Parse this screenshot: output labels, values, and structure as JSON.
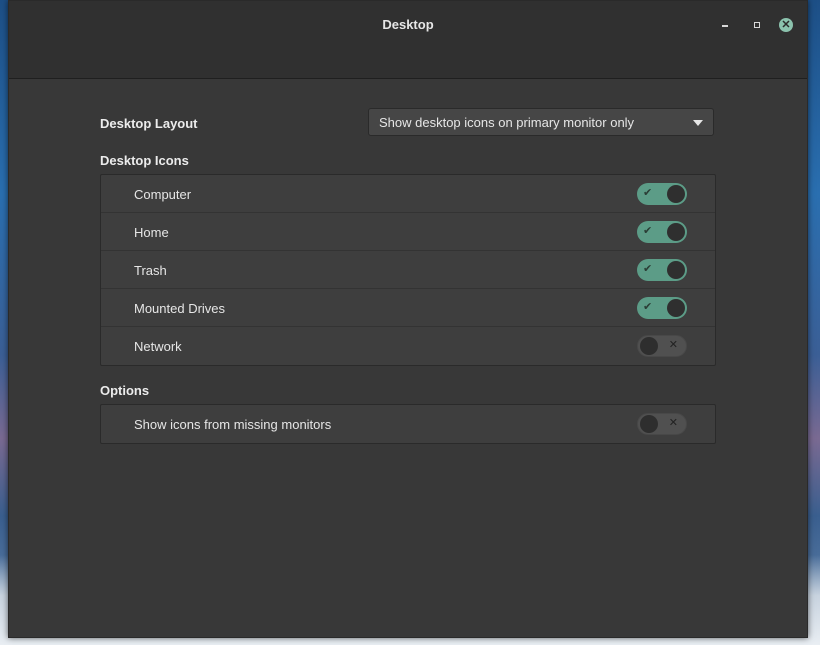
{
  "window": {
    "title": "Desktop"
  },
  "layout": {
    "label": "Desktop Layout",
    "selected": "Show desktop icons on primary monitor only"
  },
  "desktop_icons": {
    "label": "Desktop Icons",
    "items": [
      {
        "label": "Computer",
        "enabled": true
      },
      {
        "label": "Home",
        "enabled": true
      },
      {
        "label": "Trash",
        "enabled": true
      },
      {
        "label": "Mounted Drives",
        "enabled": true
      },
      {
        "label": "Network",
        "enabled": false
      }
    ]
  },
  "options": {
    "label": "Options",
    "items": [
      {
        "label": "Show icons from missing monitors",
        "enabled": false
      }
    ]
  },
  "glyphs": {
    "on": "✔",
    "off": "✕",
    "close": "✕"
  },
  "colors": {
    "accent": "#5c9c87",
    "close_button": "#8bc2ad"
  }
}
